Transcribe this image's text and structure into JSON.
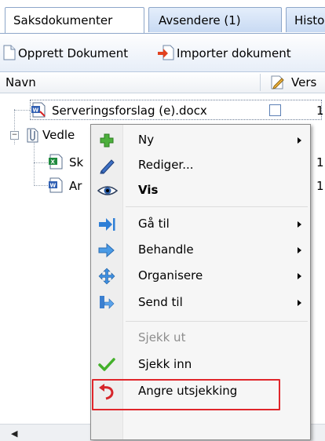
{
  "tabs": [
    {
      "label": "Saksdokumenter",
      "active": true
    },
    {
      "label": "Avsendere (1)",
      "active": false
    },
    {
      "label": "Histo",
      "active": false
    }
  ],
  "toolbar": {
    "create_label": "Opprett Dokument",
    "import_label": "Importer dokument"
  },
  "columns": {
    "name": "Navn",
    "version": "Vers"
  },
  "tree": {
    "items": [
      {
        "label": "Serveringsforslag (e).docx",
        "version": "1",
        "icon": "word-doc-icon"
      },
      {
        "label": "Vedle",
        "icon": "attachment-folder-icon"
      },
      {
        "label": "Sk",
        "version": "1",
        "icon": "excel-doc-icon"
      },
      {
        "label": "Ar",
        "version": "1",
        "icon": "word-doc-icon"
      }
    ]
  },
  "context_menu": {
    "items": [
      {
        "label": "Ny",
        "icon": "plus-icon",
        "submenu": true
      },
      {
        "label": "Rediger...",
        "icon": "pencil-icon",
        "submenu": false
      },
      {
        "label": "Vis",
        "icon": "eye-icon",
        "submenu": false,
        "bold": true
      },
      {
        "label": "Gå til",
        "icon": "goto-arrow-icon",
        "submenu": true
      },
      {
        "label": "Behandle",
        "icon": "process-arrow-icon",
        "submenu": true
      },
      {
        "label": "Organisere",
        "icon": "move-icon",
        "submenu": true
      },
      {
        "label": "Send til",
        "icon": "send-to-icon",
        "submenu": true
      },
      {
        "label": "Sjekk ut",
        "icon": "",
        "submenu": false,
        "disabled": true
      },
      {
        "label": "Sjekk inn",
        "icon": "checkmark-icon",
        "submenu": false,
        "highlighted": true
      },
      {
        "label": "Angre utsjekking",
        "icon": "undo-icon",
        "submenu": false
      }
    ]
  },
  "colors": {
    "accent_border": "#8da6c9",
    "highlight": "#e0262b"
  }
}
